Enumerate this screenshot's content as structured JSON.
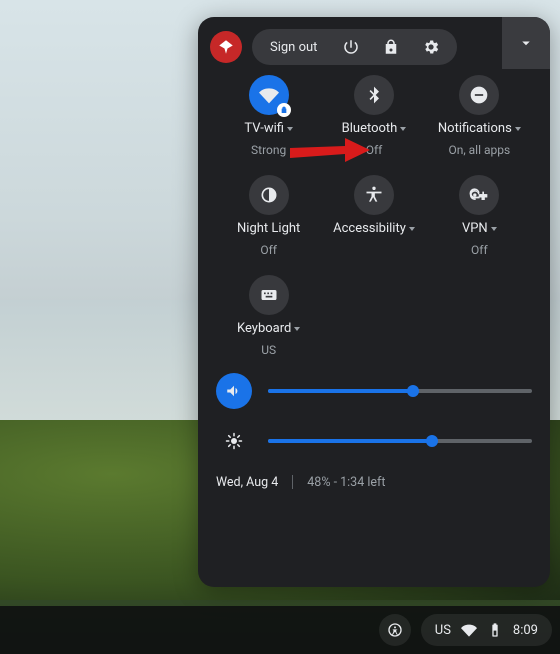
{
  "header": {
    "sign_out": "Sign out"
  },
  "tiles": {
    "wifi": {
      "label": "TV-wifi",
      "sub": "Strong"
    },
    "bluetooth": {
      "label": "Bluetooth",
      "sub": "Off"
    },
    "notifications": {
      "label": "Notifications",
      "sub": "On, all apps"
    },
    "nightlight": {
      "label": "Night Light",
      "sub": "Off"
    },
    "accessibility": {
      "label": "Accessibility",
      "sub": ""
    },
    "vpn": {
      "label": "VPN",
      "sub": "Off"
    },
    "keyboard": {
      "label": "Keyboard",
      "sub": "US"
    }
  },
  "sliders": {
    "volume_pct": 55,
    "brightness_pct": 62
  },
  "footer": {
    "date": "Wed, Aug 4",
    "battery": "48% - 1:34 left"
  },
  "shelf": {
    "ime": "US",
    "clock": "8:09"
  },
  "colors": {
    "accent": "#1a73e8",
    "panel_bg": "#1f2023",
    "muted": "#9aa0a6"
  }
}
